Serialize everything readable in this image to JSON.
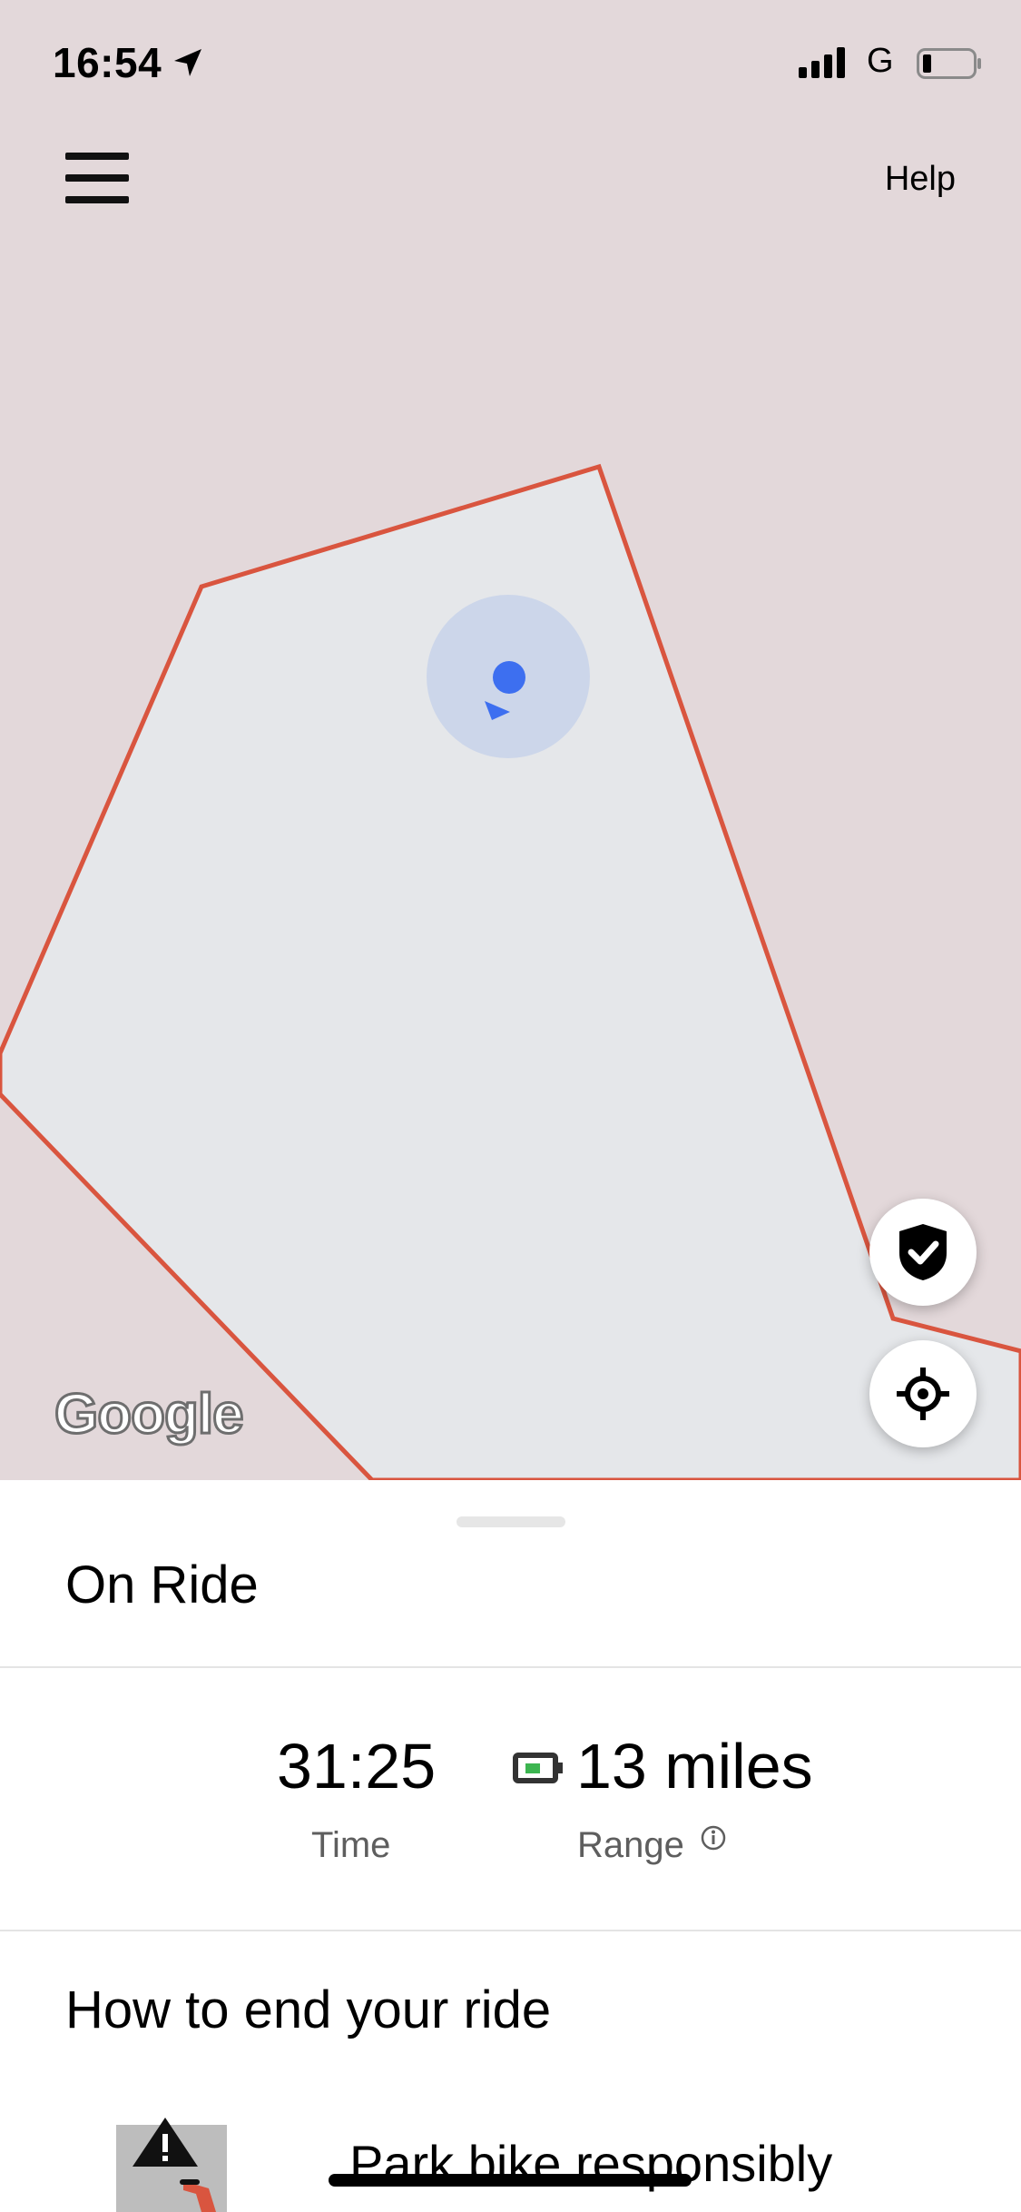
{
  "status_bar": {
    "time": "16:54",
    "network": "G",
    "icons": [
      "location-arrow-icon",
      "signal-bars-icon",
      "battery-low-icon"
    ]
  },
  "header": {
    "menu_icon": "hamburger-menu-icon",
    "help_label": "Help"
  },
  "map": {
    "attribution": "Google",
    "zone_border_color": "#d9553f",
    "outside_color": "#e3d8da",
    "inside_color": "#e5e7ea",
    "user_dot_color": "#3d6ff0",
    "safety_button_icon": "shield-check-icon",
    "recenter_button_icon": "crosshair-locate-icon"
  },
  "ride": {
    "status_title": "On Ride",
    "time_value": "31:25",
    "time_label": "Time",
    "range_value": "13 miles",
    "range_label": "Range",
    "range_icon": "battery-icon",
    "info_icon": "info-icon"
  },
  "end_ride": {
    "section_title": "How to end your ride",
    "tips": [
      {
        "title": "Park bike responsibly",
        "icon": "warning-sign-icon"
      }
    ]
  },
  "colors": {
    "battery_fill": "#3cb550",
    "secondary_text": "#5e5e5e"
  }
}
